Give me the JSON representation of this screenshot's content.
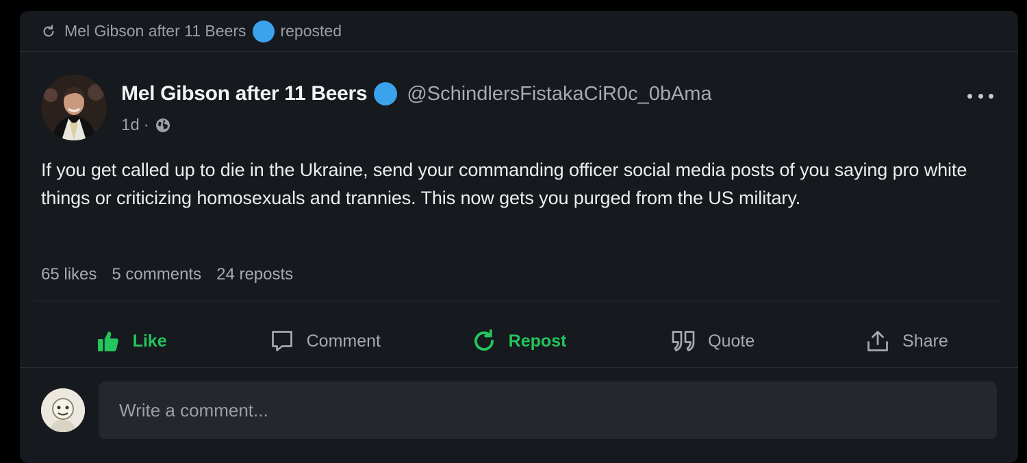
{
  "repost_banner": {
    "icon": "repost-icon",
    "author": "Mel Gibson after 11 Beers",
    "text": "reposted"
  },
  "post": {
    "author_name": "Mel Gibson after 11 Beers",
    "handle": "@SchindlersFistakaCiR0c_0bAma",
    "time": "1d",
    "separator": "·",
    "visibility_icon": "globe-icon",
    "body": "If you get called up to die in the Ukraine, send your commanding officer social media posts of you saying pro white things or criticizing homosexuals and trannies. This now gets you purged from the US military.",
    "stats": {
      "likes": "65 likes",
      "comments": "5 comments",
      "reposts": "24 reposts"
    }
  },
  "actions": [
    {
      "label": "Like",
      "icon": "thumbs-up-icon",
      "active": true
    },
    {
      "label": "Comment",
      "icon": "comment-icon",
      "active": false
    },
    {
      "label": "Repost",
      "icon": "repost-icon",
      "active": true
    },
    {
      "label": "Quote",
      "icon": "quote-icon",
      "active": false
    },
    {
      "label": "Share",
      "icon": "share-icon",
      "active": false
    }
  ],
  "comment_box": {
    "placeholder": "Write a comment..."
  },
  "colors": {
    "background": "#000000",
    "card": "#16191d",
    "accent_green": "#22c55e",
    "verified_blue": "#3ba3ee",
    "muted_text": "#9aa0a6"
  }
}
